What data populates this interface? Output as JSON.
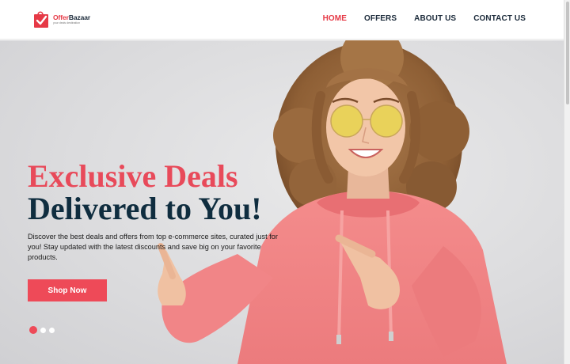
{
  "brand": {
    "name_part1": "Offer",
    "name_part2": "Bazaar",
    "tagline": "your deals destination",
    "colors": {
      "accent": "#e63946",
      "dark": "#1b2a3a"
    }
  },
  "nav": {
    "items": [
      {
        "label": "HOME",
        "active": true
      },
      {
        "label": "OFFERS",
        "active": false
      },
      {
        "label": "ABOUT US",
        "active": false
      },
      {
        "label": "CONTACT US",
        "active": false
      }
    ]
  },
  "hero": {
    "headline_line1": "Exclusive Deals",
    "headline_line2": "Delivered to You!",
    "description": "Discover the best deals and offers from top e-commerce sites, curated just for you! Stay updated with the latest discounts and save big on your favorite products.",
    "cta_label": "Shop Now",
    "slides_total": 3,
    "slide_active": 1,
    "colors": {
      "headline_accent": "#e84a5a",
      "headline_dark": "#0f2d3f",
      "button": "#ee4a58"
    }
  }
}
